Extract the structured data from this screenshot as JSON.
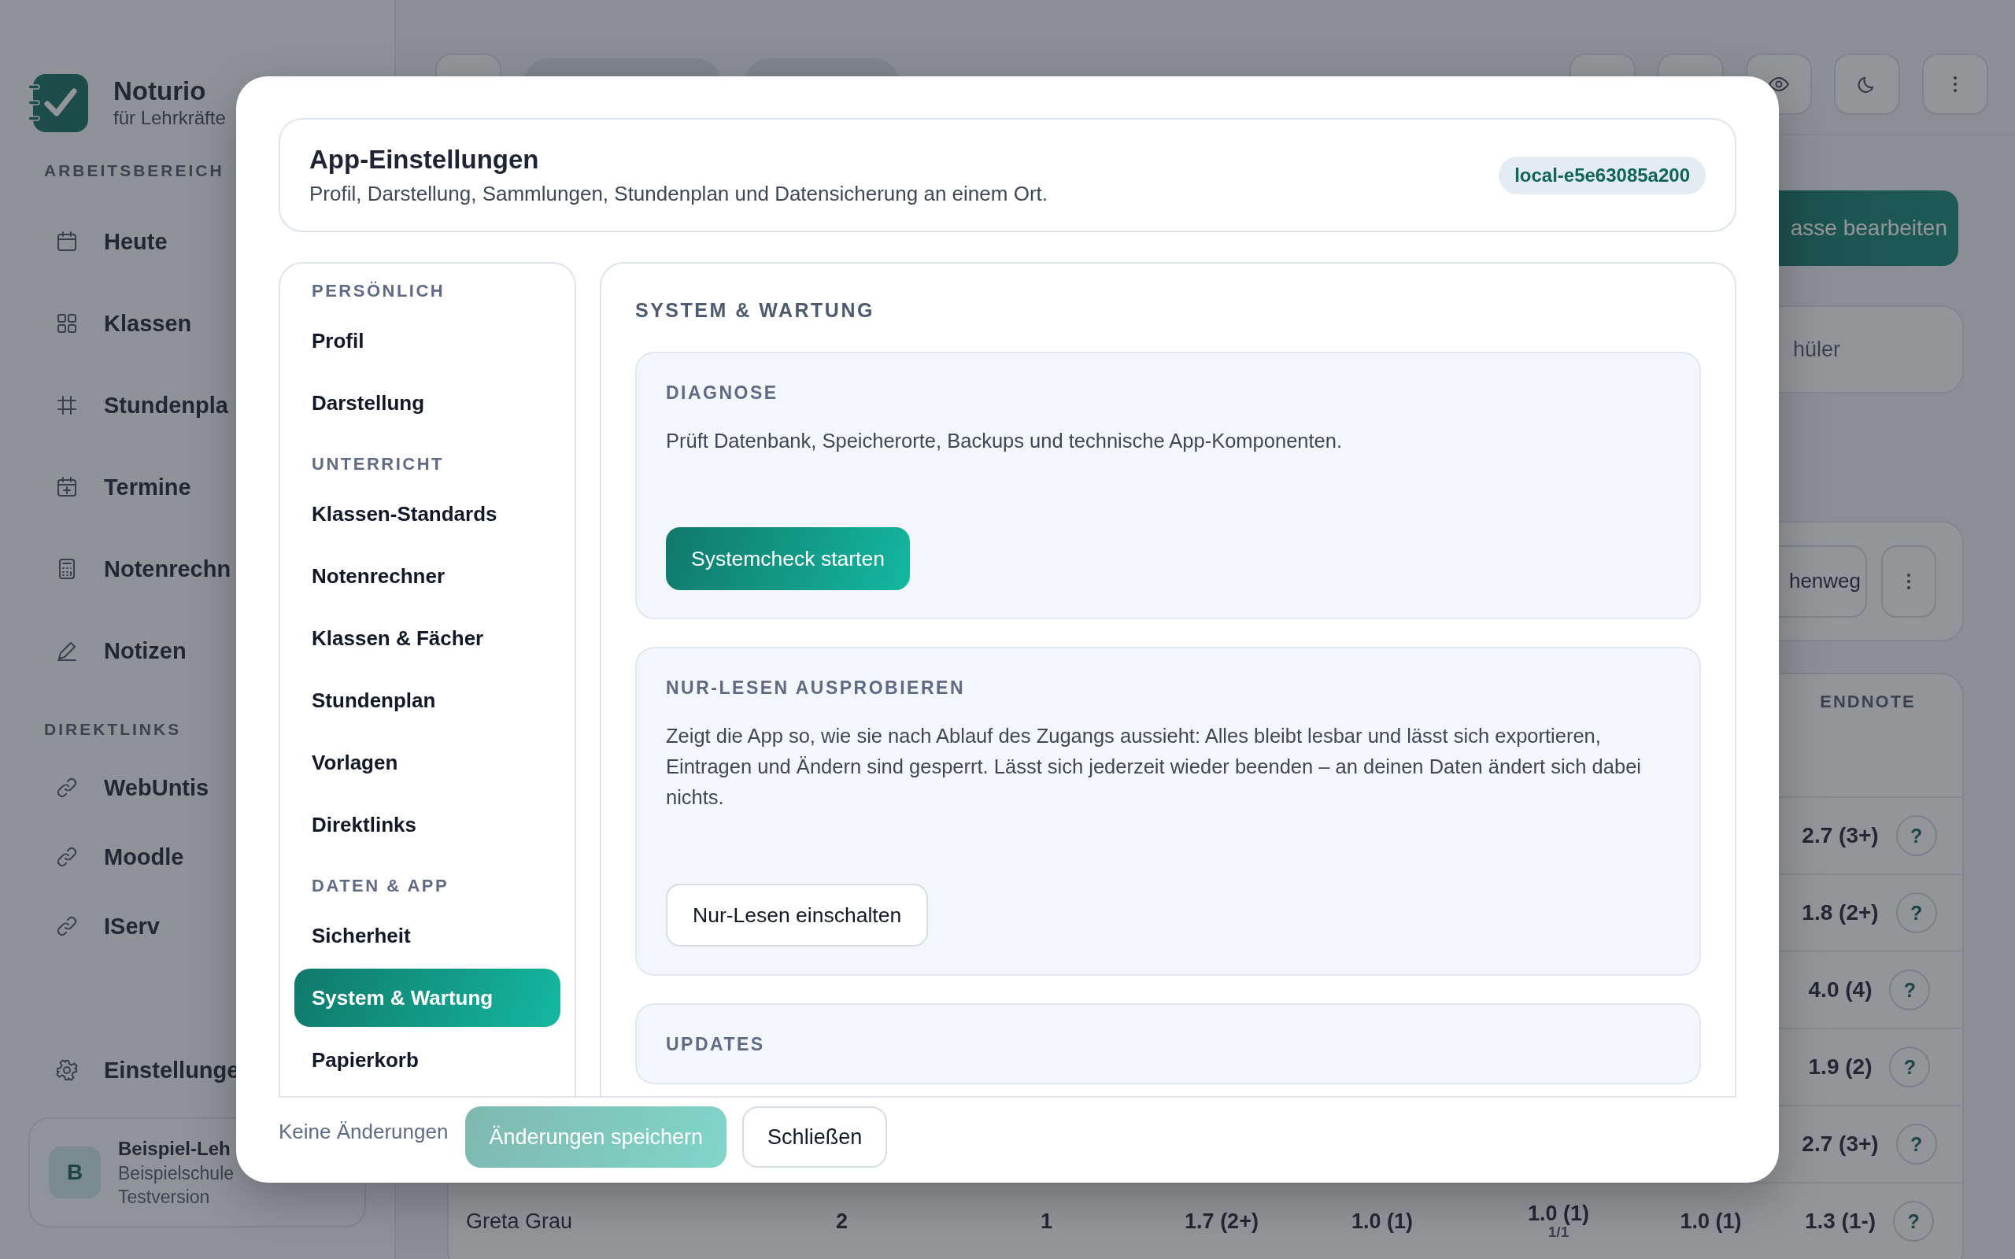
{
  "app": {
    "name": "Noturio",
    "tagline": "für Lehrkräfte"
  },
  "sidebar": {
    "sections": [
      {
        "title": "ARBEITSBEREICH",
        "items": [
          {
            "label": "Heute"
          },
          {
            "label": "Klassen"
          },
          {
            "label": "Stundenpla"
          },
          {
            "label": "Termine"
          },
          {
            "label": "Notenrechn"
          },
          {
            "label": "Notizen"
          }
        ]
      },
      {
        "title": "DIREKTLINKS",
        "items": [
          {
            "label": "WebUntis"
          },
          {
            "label": "Moodle"
          },
          {
            "label": "IServ"
          }
        ]
      }
    ],
    "settings": "Einstellunge",
    "user": {
      "initial": "B",
      "name": "Beispiel-Leh",
      "school": "Beispielschule",
      "plan": "Testversion"
    }
  },
  "main": {
    "edit_button": "asse bearbeiten",
    "students_card": "hüler",
    "toolbar_button": "henweg",
    "table": {
      "columns": [
        "ENDNOTE"
      ],
      "rows": [
        {
          "endnote": "2.7 (3+)",
          "help": "?"
        },
        {
          "endnote": "1.8 (2+)",
          "help": "?"
        },
        {
          "endnote": "4.0 (4)",
          "help": "?"
        },
        {
          "endnote": "1.9 (2)",
          "help": "?"
        },
        {
          "endnote": "2.7 (3+)",
          "help": "?"
        },
        {
          "name": "Greta Grau",
          "cells": [
            {
              "value": "2"
            },
            {
              "value": "1"
            },
            {
              "value": "1.7 (2+)"
            },
            {
              "value": "1.0 (1)"
            },
            {
              "value": "1.0 (1)",
              "sub": "1/1"
            },
            {
              "value": "1.0 (1)"
            }
          ],
          "endnote": "1.3 (1-)",
          "help": "?"
        }
      ]
    }
  },
  "dialog": {
    "title": "App-Einstellungen",
    "subtitle": "Profil, Darstellung, Sammlungen, Stundenplan und Datensicherung an einem Ort.",
    "badge": "local-e5e63085a200",
    "nav": [
      {
        "heading": "PERSÖNLICH",
        "items": [
          {
            "label": "Profil",
            "selected": false
          },
          {
            "label": "Darstellung",
            "selected": false
          }
        ]
      },
      {
        "heading": "UNTERRICHT",
        "items": [
          {
            "label": "Klassen-Standards",
            "selected": false
          },
          {
            "label": "Notenrechner",
            "selected": false
          },
          {
            "label": "Klassen & Fächer",
            "selected": false
          },
          {
            "label": "Stundenplan",
            "selected": false
          },
          {
            "label": "Vorlagen",
            "selected": false
          },
          {
            "label": "Direktlinks",
            "selected": false
          }
        ]
      },
      {
        "heading": "DATEN & APP",
        "items": [
          {
            "label": "Sicherheit",
            "selected": false
          },
          {
            "label": "System & Wartung",
            "selected": true
          },
          {
            "label": "Papierkorb",
            "selected": false
          }
        ]
      }
    ],
    "section_title": "SYSTEM & WARTUNG",
    "cards": [
      {
        "title": "DIAGNOSE",
        "text": "Prüft Datenbank, Speicherorte, Backups und technische App-Komponenten.",
        "button": {
          "label": "Systemcheck starten",
          "kind": "primary"
        }
      },
      {
        "title": "NUR-LESEN AUSPROBIEREN",
        "text": "Zeigt die App so, wie sie nach Ablauf des Zugangs aussieht: Alles bleibt lesbar und lässt sich exportieren, Eintragen und Ändern sind gesperrt. Lässt sich jederzeit wieder beenden – an deinen Daten ändert sich dabei nichts.",
        "button": {
          "label": "Nur-Lesen einschalten",
          "kind": "secondary"
        }
      },
      {
        "title": "UPDATES"
      }
    ],
    "footer": {
      "status": "Keine Änderungen",
      "save": {
        "label": "Änderungen speichern",
        "disabled": true
      },
      "close": "Schließen"
    }
  }
}
